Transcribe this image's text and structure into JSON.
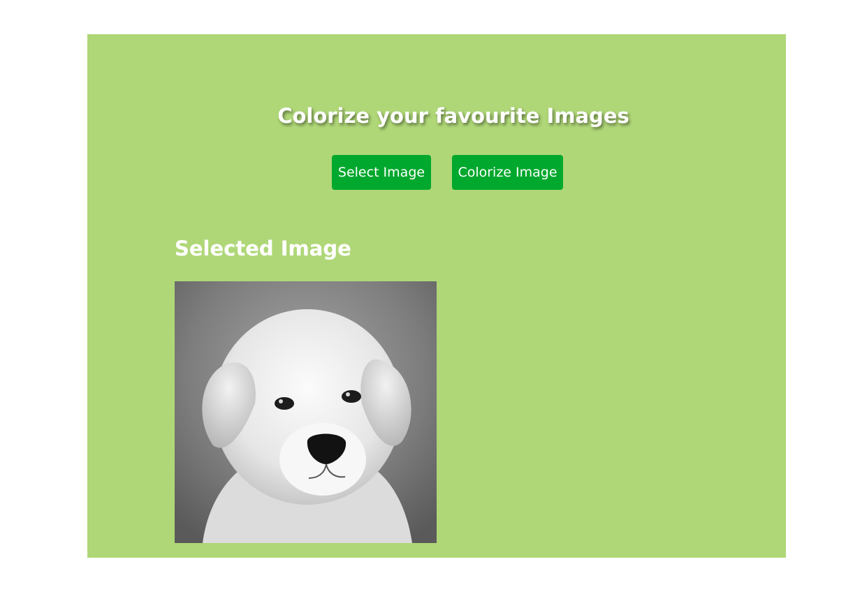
{
  "header": {
    "title": "Colorize your favourite Images"
  },
  "actions": {
    "select_label": "Select Image",
    "colorize_label": "Colorize Image"
  },
  "selected": {
    "heading": "Selected Image",
    "image_alt": "grayscale puppy photo"
  },
  "colors": {
    "panel_background": "#afd777",
    "button_background": "#00a82d",
    "text": "#ffffff"
  }
}
